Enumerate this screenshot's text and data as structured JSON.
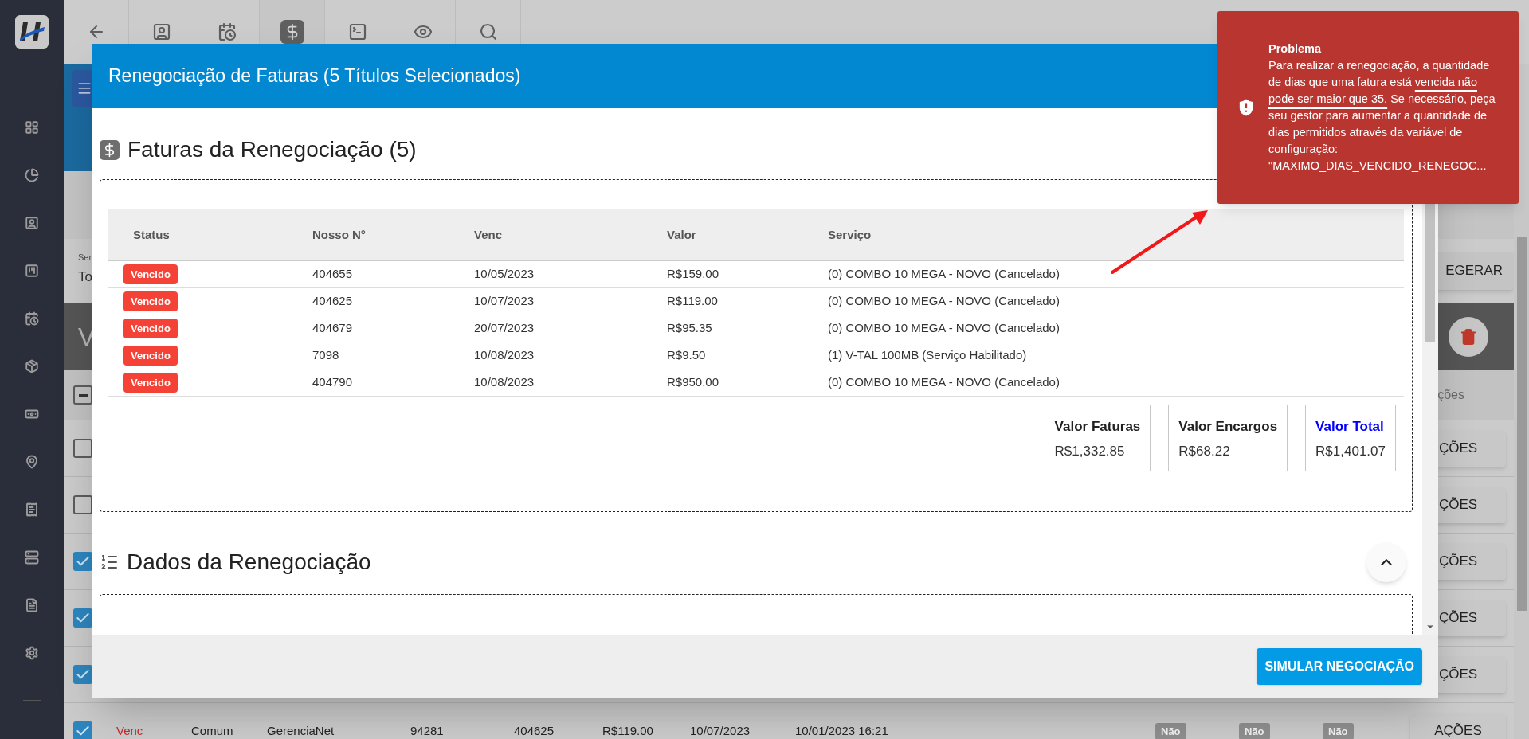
{
  "toolbar": {
    "tabs": [
      {
        "selected": false
      },
      {
        "selected": false
      },
      {
        "selected": true
      },
      {
        "selected": false
      },
      {
        "selected": false
      },
      {
        "selected": false
      }
    ]
  },
  "background": {
    "filter_label": "Ser",
    "filter_value": "To",
    "regenerate_button": "EGERAR",
    "section_title": "V",
    "header_checkbox": {
      "indeterminate": true
    },
    "actions_header": "ções",
    "rows": [
      {
        "checked": false,
        "actions": "ÇÕES"
      },
      {
        "checked": false,
        "actions": "ÇÕES"
      },
      {
        "checked": true,
        "actions": "ÇÕES"
      },
      {
        "checked": true,
        "actions": "ÇÕES"
      },
      {
        "checked": true,
        "actions": "ÇÕES"
      },
      {
        "checked": true,
        "actions": "AÇÕES",
        "status": "Venc",
        "cells": [
          "Comum",
          "GerenciaNet",
          "94281",
          "404625",
          "R$119.00",
          "10/07/2023",
          "10/01/2023 16:21"
        ],
        "flags": [
          "Não",
          "Não",
          "Não"
        ]
      }
    ]
  },
  "modal": {
    "title": "Renegociação de Faturas (5 Títulos Selecionados)",
    "invoices": {
      "heading": "Faturas da Renegociação (5)",
      "columns": [
        "Status",
        "Nosso N°",
        "Venc",
        "Valor",
        "Serviço"
      ],
      "rows": [
        {
          "status": "Vencido",
          "number": "404655",
          "due": "10/05/2023",
          "value": "R$159.00",
          "service": "(0) COMBO 10 MEGA - NOVO (Cancelado)"
        },
        {
          "status": "Vencido",
          "number": "404625",
          "due": "10/07/2023",
          "value": "R$119.00",
          "service": "(0) COMBO 10 MEGA - NOVO (Cancelado)"
        },
        {
          "status": "Vencido",
          "number": "404679",
          "due": "20/07/2023",
          "value": "R$95.35",
          "service": "(0) COMBO 10 MEGA - NOVO (Cancelado)"
        },
        {
          "status": "Vencido",
          "number": "7098",
          "due": "10/08/2023",
          "value": "R$9.50",
          "service": "(1) V-TAL 100MB (Serviço Habilitado)"
        },
        {
          "status": "Vencido",
          "number": "404790",
          "due": "10/08/2023",
          "value": "R$950.00",
          "service": "(0) COMBO 10 MEGA - NOVO (Cancelado)"
        }
      ],
      "totals": [
        {
          "label": "Valor Faturas",
          "value": "R$1,332.85",
          "highlight": false
        },
        {
          "label": "Valor Encargos",
          "value": "R$68.22",
          "highlight": false
        },
        {
          "label": "Valor Total",
          "value": "R$1,401.07",
          "highlight": true
        }
      ]
    },
    "details": {
      "heading": "Dados da Renegociação"
    },
    "primary_button": "SIMULAR NEGOCIAÇÃO"
  },
  "toast": {
    "title": "Problema",
    "message": [
      {
        "text": "Para realizar a renegociação, a quantidade de dias que uma fatura está ",
        "underlined": false
      },
      {
        "text": "vencida não pode ser maior que 35.",
        "underlined": true
      },
      {
        "text": " Se necessário, peça seu gestor para aumentar a quantidade de dias permitidos através da variável de configuração: \"MAXIMO_DIAS_VENCIDO_RENEGOC...",
        "underlined": false
      }
    ]
  }
}
